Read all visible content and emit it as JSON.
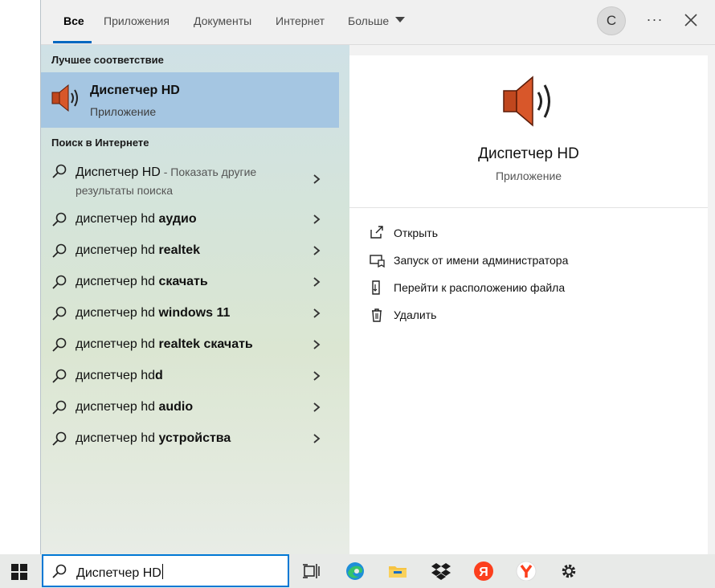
{
  "tabs": [
    {
      "label": "Все"
    },
    {
      "label": "Приложения"
    },
    {
      "label": "Документы"
    },
    {
      "label": "Интернет"
    },
    {
      "label": "Больше"
    }
  ],
  "avatar_letter": "С",
  "more_label": "···",
  "sections": {
    "best_match": "Лучшее соответствие",
    "web": "Поиск в Интернете"
  },
  "best_match": {
    "name": "Диспетчер HD",
    "type": "Приложение"
  },
  "web_results": [
    {
      "main": "Диспетчер HD",
      "hint": " - Показать другие результаты поиска"
    },
    {
      "prefix": "диспетчер hd ",
      "bold": "аудио"
    },
    {
      "prefix": "диспетчер hd ",
      "bold": "realtek"
    },
    {
      "prefix": "диспетчер hd ",
      "bold": "скачать"
    },
    {
      "prefix": "диспетчер hd ",
      "bold": "windows 11"
    },
    {
      "prefix": "диспетчер hd ",
      "bold": "realtek скачать"
    },
    {
      "prefix": "диспетчер hd",
      "bold": "d"
    },
    {
      "prefix": "диспетчер hd ",
      "bold": "audio"
    },
    {
      "prefix": "диспетчер hd ",
      "bold": "устройства"
    }
  ],
  "detail": {
    "name": "Диспетчер HD",
    "type": "Приложение",
    "actions": [
      {
        "label": "Открыть",
        "icon": "open-icon"
      },
      {
        "label": "Запуск от имени администратора",
        "icon": "run-as-admin-icon"
      },
      {
        "label": "Перейти к расположению файла",
        "icon": "file-location-icon"
      },
      {
        "label": "Удалить",
        "icon": "trash-icon"
      }
    ]
  },
  "search": {
    "value": "Диспетчер HD"
  },
  "taskbar_icons": [
    "windows-start-icon",
    "task-view-icon",
    "edge-icon",
    "file-explorer-icon",
    "dropbox-icon",
    "yandex-icon",
    "yandex-browser-icon",
    "settings-gear-icon"
  ],
  "colors": {
    "accent": "#0078d4",
    "selected": "#a5c6e2",
    "speaker": "#c0471e"
  }
}
